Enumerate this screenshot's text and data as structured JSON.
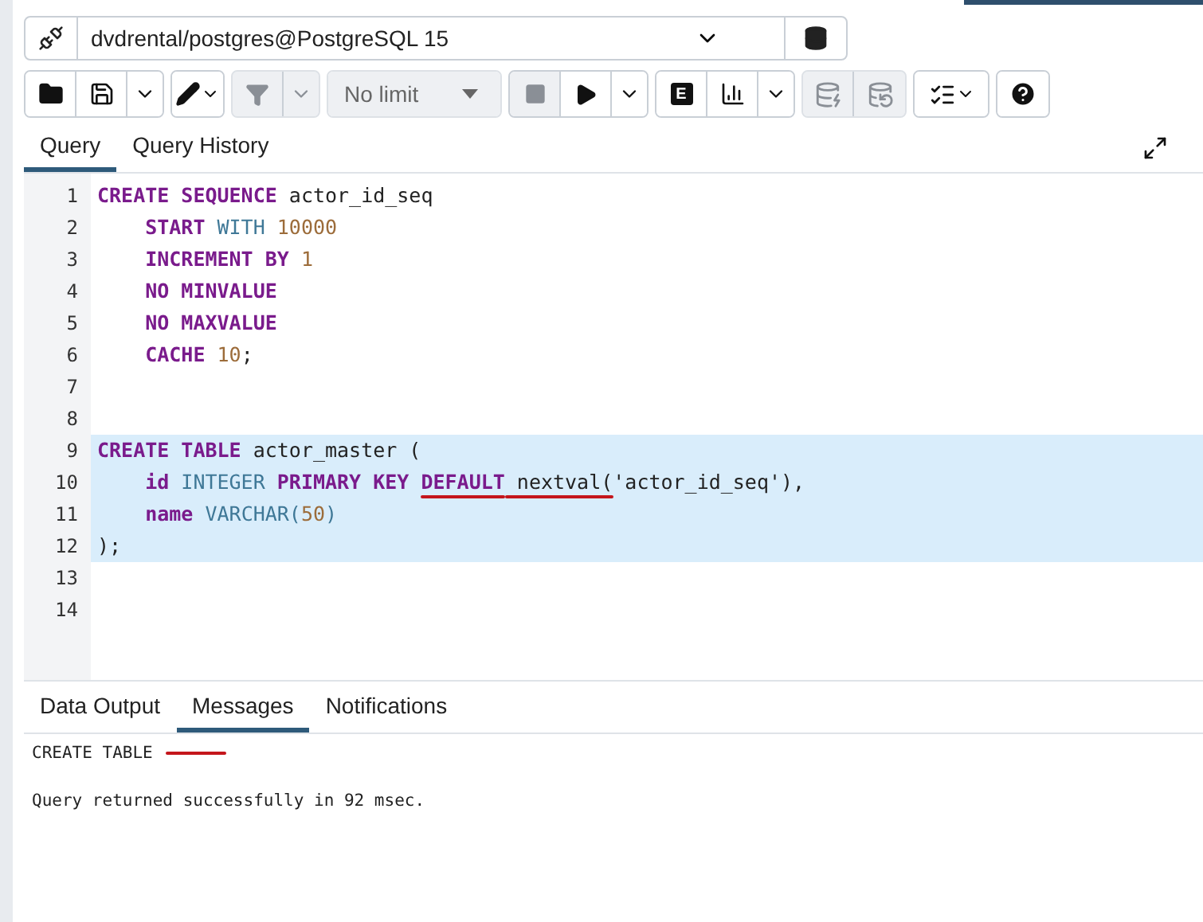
{
  "connection": {
    "label": "dvdrental/postgres@PostgreSQL 15"
  },
  "toolbar": [
    [
      {
        "kind": "folder",
        "disabled": false
      },
      {
        "kind": "save",
        "disabled": false
      },
      {
        "kind": "caret",
        "disabled": false
      }
    ],
    [
      {
        "kind": "pencil",
        "disabled": false
      }
    ],
    [
      {
        "kind": "filter",
        "disabled": true
      },
      {
        "kind": "caret",
        "disabled": true
      }
    ],
    [
      {
        "kind": "limit",
        "text": "No limit",
        "disabled": true
      }
    ],
    [
      {
        "kind": "stop",
        "disabled": true
      },
      {
        "kind": "play",
        "disabled": false
      },
      {
        "kind": "caret",
        "disabled": false
      }
    ],
    [
      {
        "kind": "explain",
        "text": "E",
        "disabled": false
      },
      {
        "kind": "chart",
        "disabled": false
      },
      {
        "kind": "caret",
        "disabled": false
      }
    ],
    [
      {
        "kind": "commit",
        "disabled": true
      },
      {
        "kind": "rollback",
        "disabled": true
      }
    ],
    [
      {
        "kind": "macros",
        "disabled": false
      }
    ],
    [
      {
        "kind": "help",
        "disabled": false
      }
    ]
  ],
  "editor_tabs": [
    {
      "label": "Query",
      "selected": true
    },
    {
      "label": "Query History",
      "selected": false
    }
  ],
  "code_lines": [
    {
      "number": "1",
      "selected": false,
      "tokens": [
        {
          "kind": "kw",
          "text": "CREATE SEQUENCE"
        },
        {
          "kind": "plain",
          "text": " actor_id_seq"
        }
      ]
    },
    {
      "number": "2",
      "selected": false,
      "tokens": [
        {
          "kind": "kw",
          "text": "    START"
        },
        {
          "kind": "type",
          "text": " WITH"
        },
        {
          "kind": "num",
          "text": " 10000"
        }
      ]
    },
    {
      "number": "3",
      "selected": false,
      "tokens": [
        {
          "kind": "kw",
          "text": "    INCREMENT BY"
        },
        {
          "kind": "num",
          "text": " 1"
        }
      ]
    },
    {
      "number": "4",
      "selected": false,
      "tokens": [
        {
          "kind": "kw",
          "text": "    NO MINVALUE"
        }
      ]
    },
    {
      "number": "5",
      "selected": false,
      "tokens": [
        {
          "kind": "kw",
          "text": "    NO MAXVALUE"
        }
      ]
    },
    {
      "number": "6",
      "selected": false,
      "tokens": [
        {
          "kind": "kw",
          "text": "    CACHE"
        },
        {
          "kind": "num",
          "text": " 10"
        },
        {
          "kind": "plain",
          "text": ";"
        }
      ]
    },
    {
      "number": "7"
    },
    {
      "number": "8"
    },
    {
      "number": "9",
      "selected": true,
      "tokens": [
        {
          "kind": "kw",
          "text": "CREATE TABLE"
        },
        {
          "kind": "plain",
          "text": " actor_master ("
        }
      ]
    },
    {
      "number": "10",
      "selected": true,
      "tokens": [
        {
          "kind": "kw",
          "text": "    id"
        },
        {
          "kind": "type",
          "text": " INTEGER"
        },
        {
          "kind": "kw",
          "text": " PRIMARY KEY "
        },
        {
          "kind": "kw",
          "text": "DEFAULT",
          "annotated": true
        },
        {
          "kind": "plain",
          "text": " nextval(",
          "annotated": true
        },
        {
          "kind": "plain",
          "text": "'actor_id_seq'),"
        }
      ]
    },
    {
      "number": "11",
      "selected": true,
      "tokens": [
        {
          "kind": "kw",
          "text": "    name"
        },
        {
          "kind": "type",
          "text": " VARCHAR("
        },
        {
          "kind": "num",
          "text": "50"
        },
        {
          "kind": "type",
          "text": ")"
        }
      ]
    },
    {
      "number": "12",
      "selected": true,
      "tokens": [
        {
          "kind": "plain",
          "text": ");"
        }
      ]
    },
    {
      "number": "13"
    },
    {
      "number": "14"
    }
  ],
  "output_tabs": [
    {
      "label": "Data Output",
      "selected": false
    },
    {
      "label": "Messages",
      "selected": true
    },
    {
      "label": "Notifications",
      "selected": false
    }
  ],
  "messages": [
    {
      "text": "CREATE TABLE",
      "annotated": true
    },
    {
      "text": "Query returned successfully in 92 msec."
    }
  ]
}
